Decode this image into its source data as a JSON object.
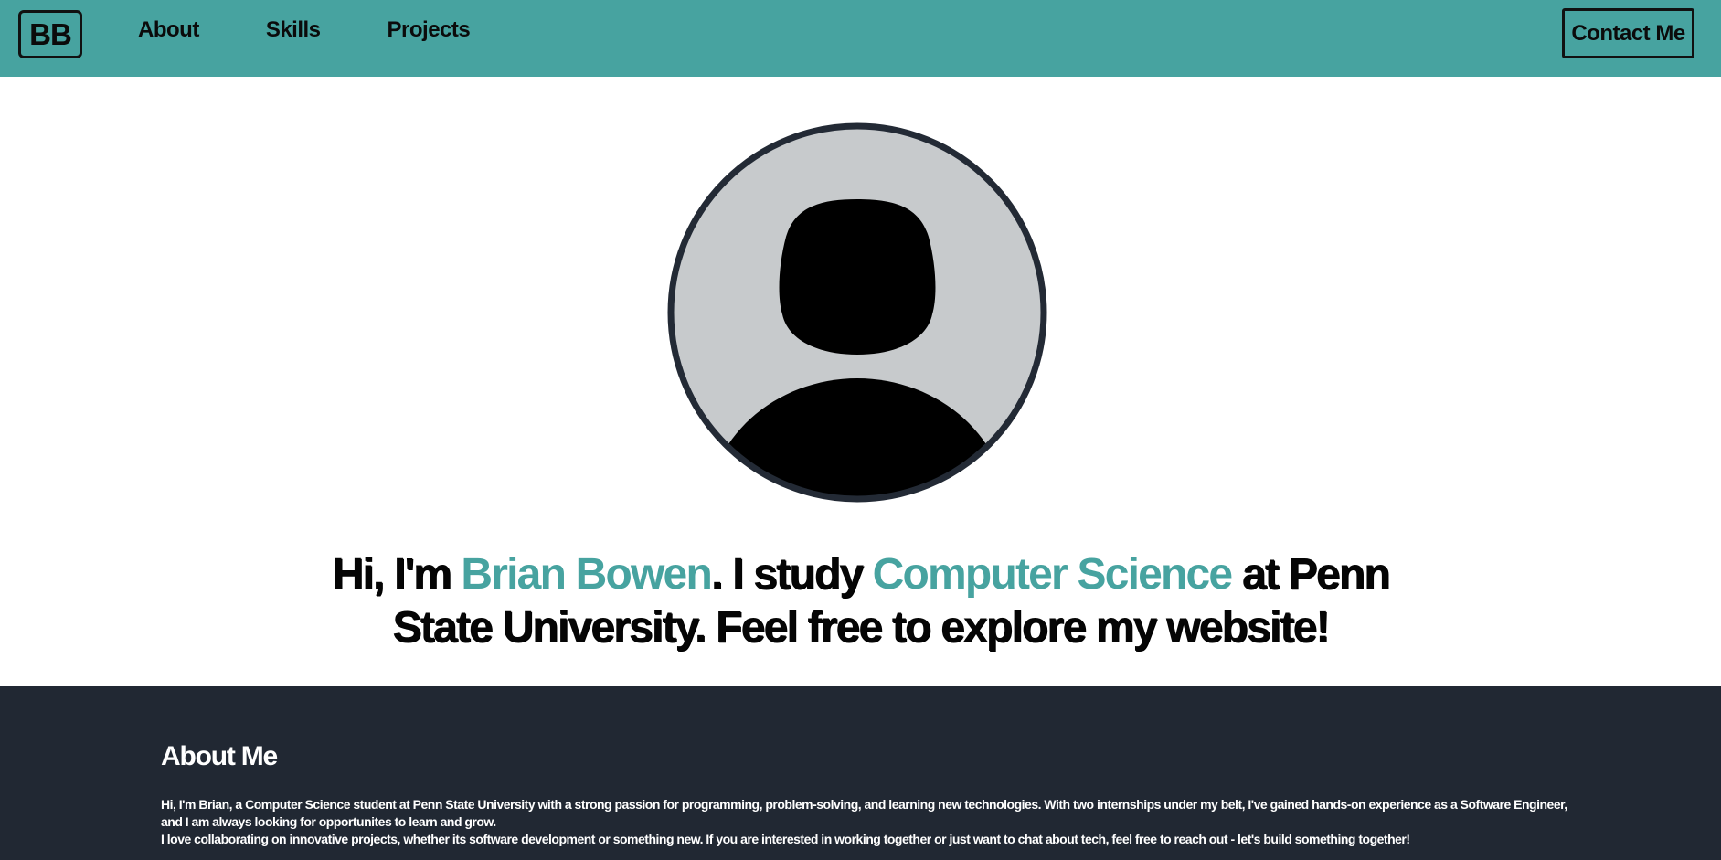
{
  "nav": {
    "logo": "BB",
    "links": [
      "About",
      "Skills",
      "Projects"
    ],
    "contact_label": "Contact Me"
  },
  "hero": {
    "avatar_icon": "user-avatar-icon",
    "intro_1": "Hi, I'm ",
    "name": "Brian Bowen",
    "intro_2": ". I study ",
    "field": "Computer Science",
    "intro_3": " at Penn",
    "line_2": "State University. Feel free to explore my website!"
  },
  "about": {
    "title": "About Me",
    "paragraph_1": "Hi, I'm Brian, a Computer Science student at Penn State University with a strong passion for programming, problem-solving, and learning new technologies. With two internships under my belt, I've gained hands-on experience as a Software Engineer, and I am always looking for opportunites to learn and grow.",
    "paragraph_2": "I love collaborating on innovative projects, whether its software development or something new. If you are interested in working together or just want to chat about tech, feel free to reach out - let's build something together!"
  },
  "colors": {
    "accent": "#47a3a0",
    "dark": "#212833",
    "avatar_bg": "#c7cacc"
  }
}
